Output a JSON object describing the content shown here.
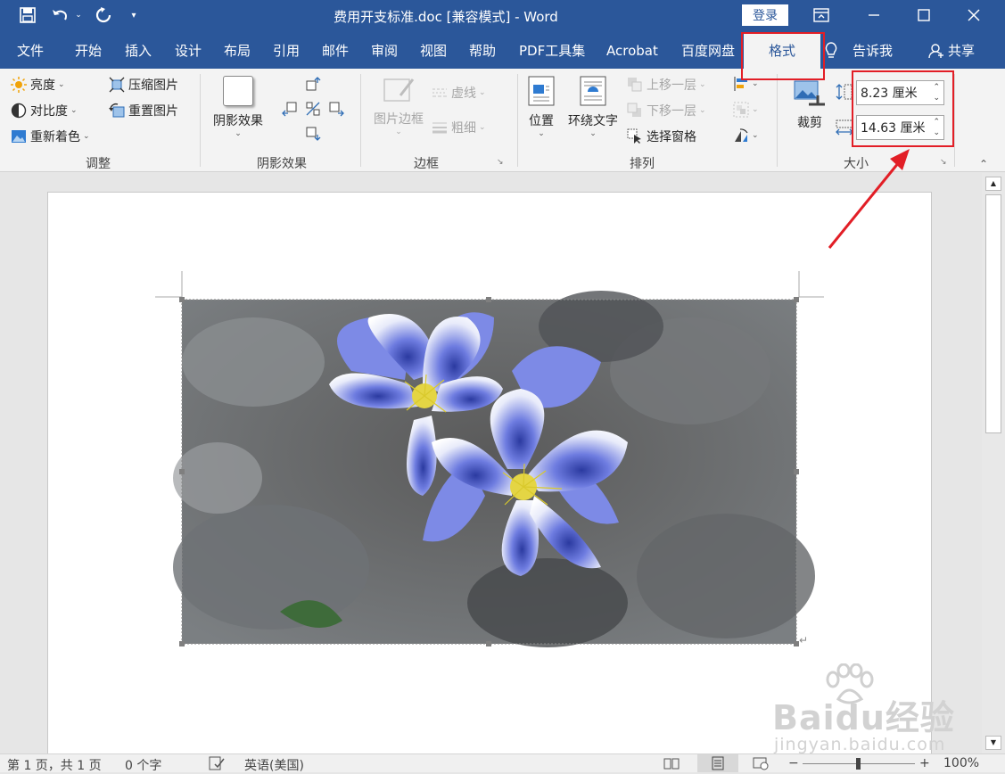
{
  "window": {
    "title": "费用开支标准.doc [兼容模式] - Word",
    "login": "登录"
  },
  "tabs": [
    "文件",
    "开始",
    "插入",
    "设计",
    "布局",
    "引用",
    "邮件",
    "审阅",
    "视图",
    "帮助",
    "PDF工具集",
    "Acrobat",
    "百度网盘",
    "格式",
    "告诉我",
    "共享"
  ],
  "ribbon": {
    "adjust": {
      "brightness": "亮度",
      "contrast": "对比度",
      "recolor": "重新着色",
      "compress": "压缩图片",
      "reset": "重置图片",
      "label": "调整"
    },
    "shadow": {
      "effect": "阴影效果",
      "label": "阴影效果"
    },
    "border": {
      "picture_border": "图片边框",
      "dashes": "虚线",
      "weight": "粗细",
      "label": "边框"
    },
    "arrange": {
      "position": "位置",
      "wrap_text": "环绕文字",
      "bring_forward": "上移一层",
      "send_backward": "下移一层",
      "selection_pane": "选择窗格",
      "label": "排列"
    },
    "size": {
      "crop": "裁剪",
      "height": "8.23 厘米",
      "width": "14.63 厘米",
      "label": "大小"
    }
  },
  "status": {
    "page": "第 1 页，共 1 页",
    "words": "0 个字",
    "language": "英语(美国)",
    "zoom": "100%"
  },
  "watermark": {
    "brand": "Baidu经验",
    "url": "jingyan.baidu.com"
  },
  "colors": {
    "accent": "#2b579a",
    "highlight": "#e21e26"
  }
}
